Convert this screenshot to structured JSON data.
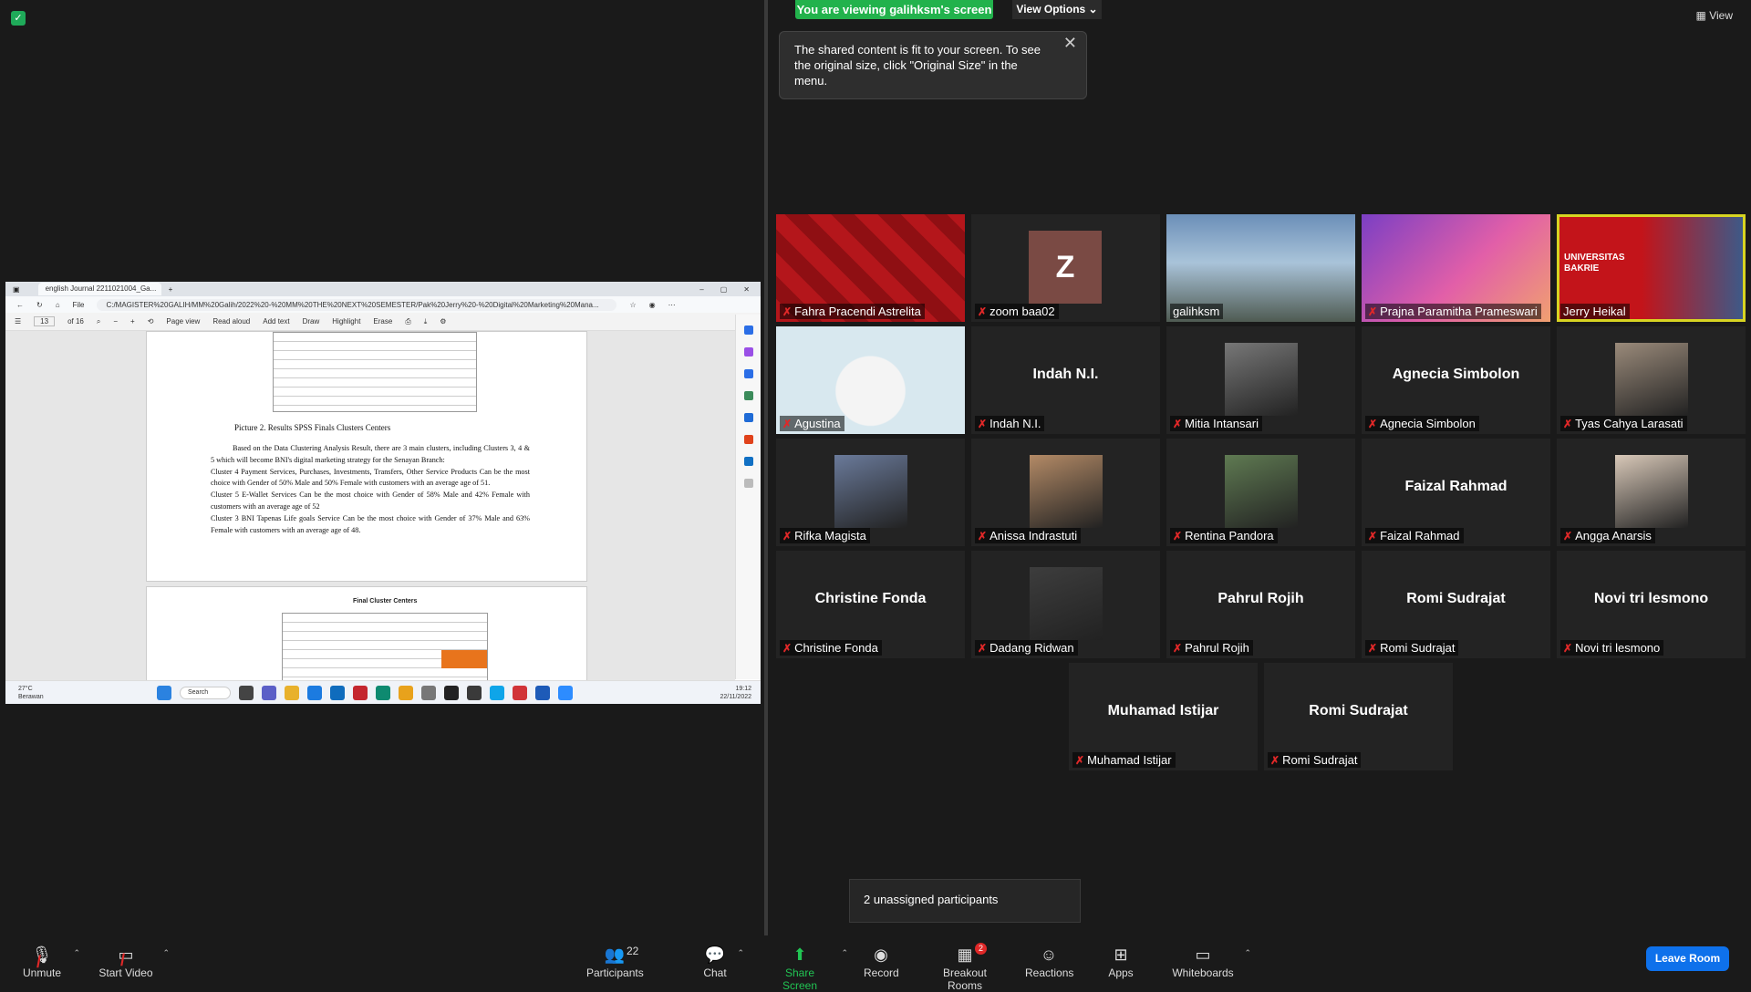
{
  "banner": {
    "viewing": "You are viewing galihksm's screen",
    "view_options": "View Options ⌄",
    "view": "▦ View"
  },
  "tooltip": {
    "text": "The shared content is fit to your screen. To see the original size, click \"Original Size\" in the menu."
  },
  "shared_screen": {
    "tab_title": "english Journal 2211021004_Ga...",
    "url": "C:/MAGISTER%20GALIH/MM%20Galih/2022%20-%20MM%20THE%20NEXT%20SEMESTER/Pak%20Jerry%20-%20Digital%20Marketing%20Mana...",
    "file_label": "File",
    "page_current": "13",
    "page_total": "of 16",
    "tools": [
      "Page view",
      "Read aloud",
      "Add text",
      "Draw",
      "Highlight",
      "Erase"
    ],
    "caption": "Picture 2. Results SPSS Finals Clusters Centers",
    "paragraphs": [
      "Based on the Data Clustering Analysis Result, there are 3 main clusters, including Clusters 3, 4 & 5 which will become BNI's digital marketing strategy for the Senayan Branch:",
      "Cluster 4 Payment Services, Purchases, Investments, Transfers, Other Service Products Can be the most choice with Gender of 50% Male and 50% Female with customers with an average age of 51.",
      "Cluster 5 E-Wallet Services Can be the most choice with Gender of 58% Male and 42% Female with customers with an average age of 52",
      "Cluster 3 BNI Tapenas Life goals Service Can be the most choice with Gender of 37% Male and 63% Female with customers with an average age of 48."
    ],
    "page2_heading": "Final Cluster Centers",
    "weather_temp": "27°C",
    "weather_desc": "Berawan",
    "search_label": "Search",
    "clock_time": "19:12",
    "clock_date": "22/11/2022"
  },
  "participants_tiles": [
    {
      "name": "Fahra Pracendi Astrelita",
      "muted": true,
      "kind": "video"
    },
    {
      "name": "zoom baa02",
      "muted": true,
      "kind": "avatar",
      "avatar_letter": "Z"
    },
    {
      "name": "galihksm",
      "muted": false,
      "kind": "video"
    },
    {
      "name": "Prajna Paramitha Prameswari",
      "muted": true,
      "kind": "video"
    },
    {
      "name": "Jerry Heikal",
      "muted": false,
      "kind": "video",
      "active": true
    },
    {
      "name": "Agustina",
      "muted": true,
      "kind": "video"
    },
    {
      "name": "Indah N.I.",
      "muted": true,
      "kind": "name"
    },
    {
      "name": "Mitia Intansari",
      "muted": true,
      "kind": "photo"
    },
    {
      "name": "Agnecia Simbolon",
      "muted": true,
      "kind": "name"
    },
    {
      "name": "Tyas Cahya Larasati",
      "muted": true,
      "kind": "photo"
    },
    {
      "name": "Rifka Magista",
      "muted": true,
      "kind": "photo"
    },
    {
      "name": "Anissa Indrastuti",
      "muted": true,
      "kind": "photo"
    },
    {
      "name": "Rentina Pandora",
      "muted": true,
      "kind": "photo"
    },
    {
      "name": "Faizal Rahmad",
      "muted": true,
      "kind": "name"
    },
    {
      "name": "Angga Anarsis",
      "muted": true,
      "kind": "photo"
    },
    {
      "name": "Christine Fonda",
      "muted": true,
      "kind": "name"
    },
    {
      "name": "Dadang Ridwan",
      "muted": true,
      "kind": "photo"
    },
    {
      "name": "Pahrul Rojih",
      "muted": true,
      "kind": "name"
    },
    {
      "name": "Romi Sudrajat",
      "muted": true,
      "kind": "name"
    },
    {
      "name": "Novi tri lesmono",
      "muted": true,
      "kind": "name"
    },
    {
      "name": "Muhamad Istijar",
      "muted": true,
      "kind": "name"
    },
    {
      "name": "Romi Sudrajat",
      "muted": true,
      "kind": "name"
    }
  ],
  "jerry_overlay": {
    "line1": "UNIVERSITAS",
    "line2": "BAKRIE"
  },
  "unassigned": "2 unassigned participants",
  "toolbar": {
    "unmute": "Unmute",
    "start_video": "Start Video",
    "participants": "Participants",
    "participants_count": "22",
    "chat": "Chat",
    "share_screen": "Share Screen",
    "record": "Record",
    "breakout_rooms": "Breakout Rooms",
    "breakout_badge": "2",
    "reactions": "Reactions",
    "apps": "Apps",
    "whiteboards": "Whiteboards",
    "leave": "Leave Room"
  },
  "colors": {
    "share_green": "#21c453",
    "leave_blue": "#0e71eb",
    "mute_red": "#e02828",
    "active_border": "#d7d422",
    "banner_green": "#22b24c"
  }
}
